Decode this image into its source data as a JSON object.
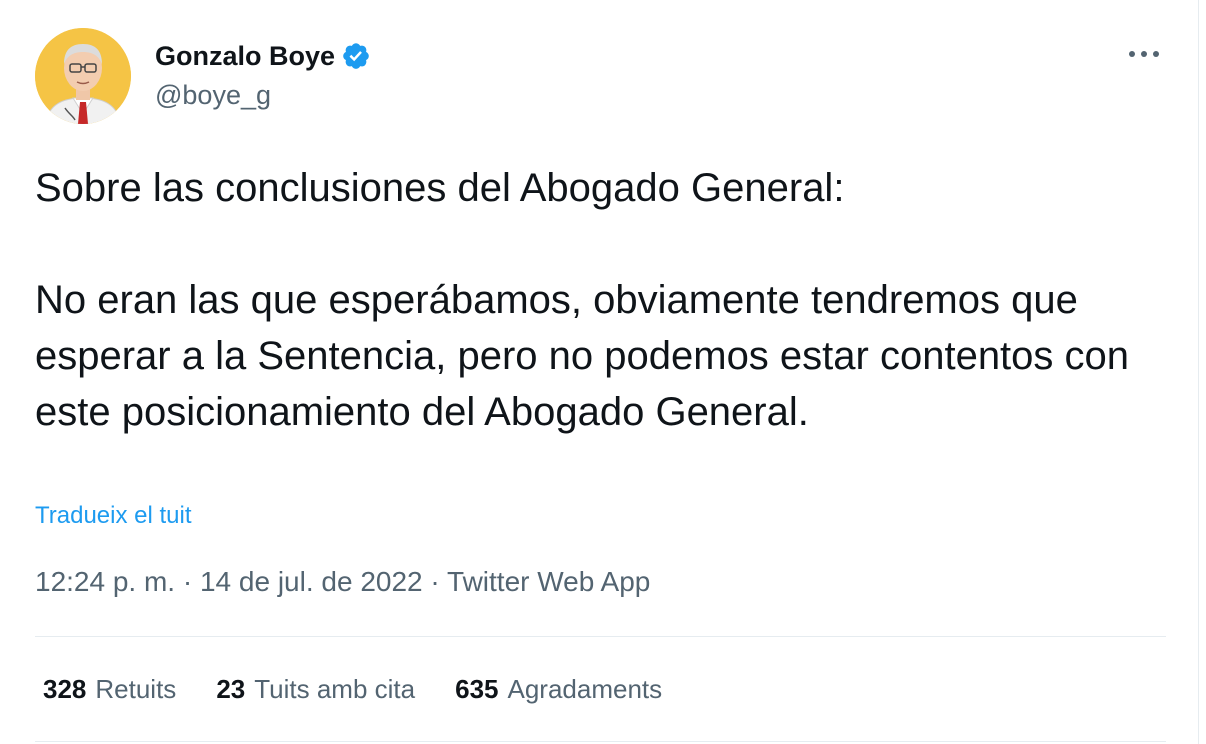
{
  "author": {
    "display_name": "Gonzalo Boye",
    "handle": "@boye_g",
    "verified": true
  },
  "tweet": {
    "paragraphs": [
      "Sobre las conclusiones del Abogado General:",
      "No eran las que esperábamos, obviamente tendremos que esperar a la Sentencia, pero no podemos estar contentos con este posicionamiento del Abogado General."
    ],
    "translate_label": "Tradueix el tuit",
    "time": "12:24 p. m.",
    "separator": "·",
    "date": "14 de jul. de 2022",
    "source": "Twitter Web App"
  },
  "stats": [
    {
      "count": "328",
      "label": "Retuits"
    },
    {
      "count": "23",
      "label": "Tuits amb cita"
    },
    {
      "count": "635",
      "label": "Agradaments"
    }
  ],
  "icons": {
    "more": "more-horizontal-icon",
    "verified": "verified-badge-icon"
  },
  "colors": {
    "accent": "#1d9bf0",
    "text_primary": "#0f1419",
    "text_secondary": "#536471",
    "divider": "#e6ecf0",
    "avatar_bg": "#f5c445"
  }
}
